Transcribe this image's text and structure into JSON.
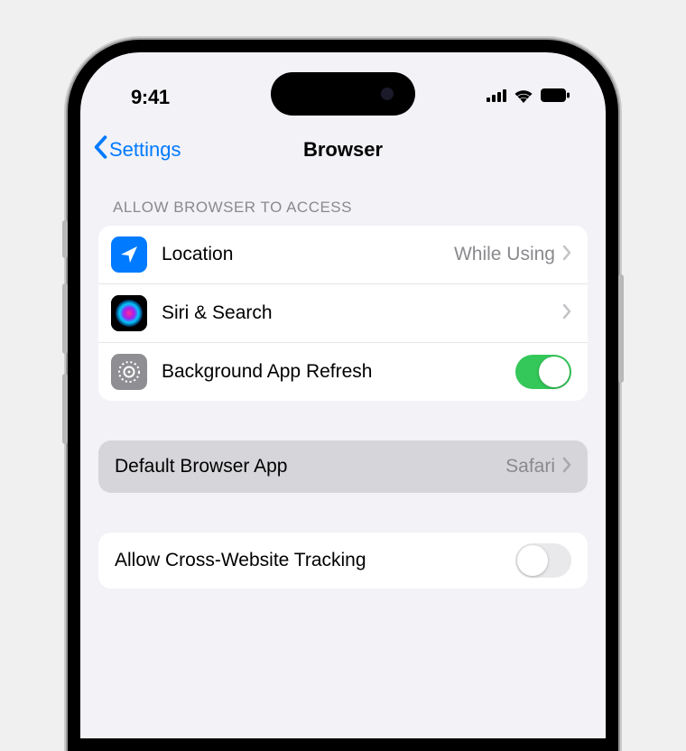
{
  "status": {
    "time": "9:41"
  },
  "nav": {
    "back": "Settings",
    "title": "Browser"
  },
  "section_header": "ALLOW BROWSER TO ACCESS",
  "access": {
    "location": {
      "label": "Location",
      "value": "While Using"
    },
    "siri": {
      "label": "Siri & Search"
    },
    "refresh": {
      "label": "Background App Refresh",
      "on": true
    }
  },
  "default_browser": {
    "label": "Default Browser App",
    "value": "Safari"
  },
  "tracking": {
    "label": "Allow Cross-Website Tracking",
    "on": false
  }
}
